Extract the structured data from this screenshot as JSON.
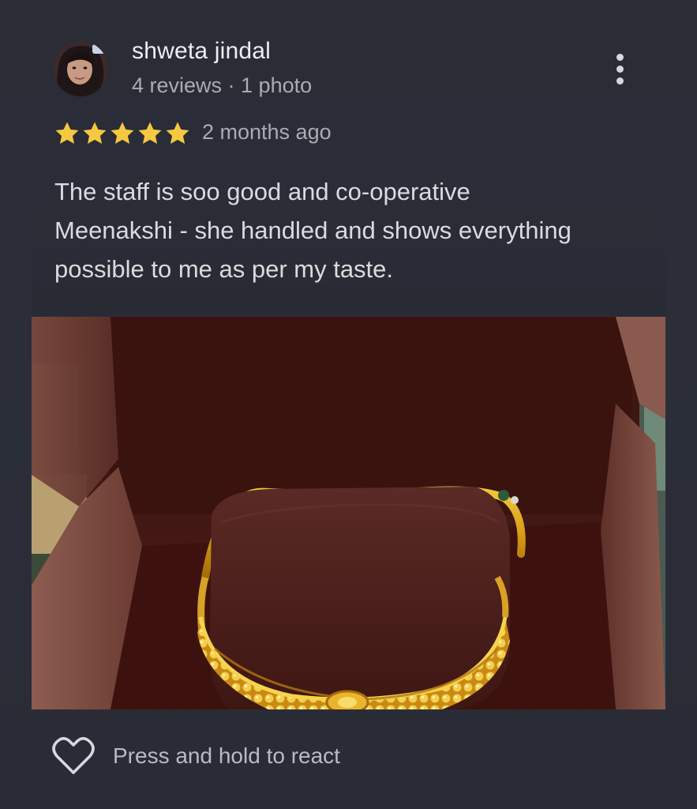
{
  "review": {
    "author": "shweta jindal",
    "meta": "4 reviews · 1 photo",
    "rating": 5,
    "time": "2 months ago",
    "text": "The staff is soo good and co-operative\nMeenakshi - she handled and shows everything\npossible to me as per my taste."
  },
  "footer": {
    "react_label": "Press and hold to react"
  },
  "colors": {
    "star": "#f5c842",
    "background": "#2a2d37",
    "text_primary": "#eceef1",
    "text_secondary": "#a9acb3"
  },
  "icons": {
    "more": "more-vert-icon",
    "heart": "heart-outline-icon",
    "star": "star-filled-icon"
  }
}
